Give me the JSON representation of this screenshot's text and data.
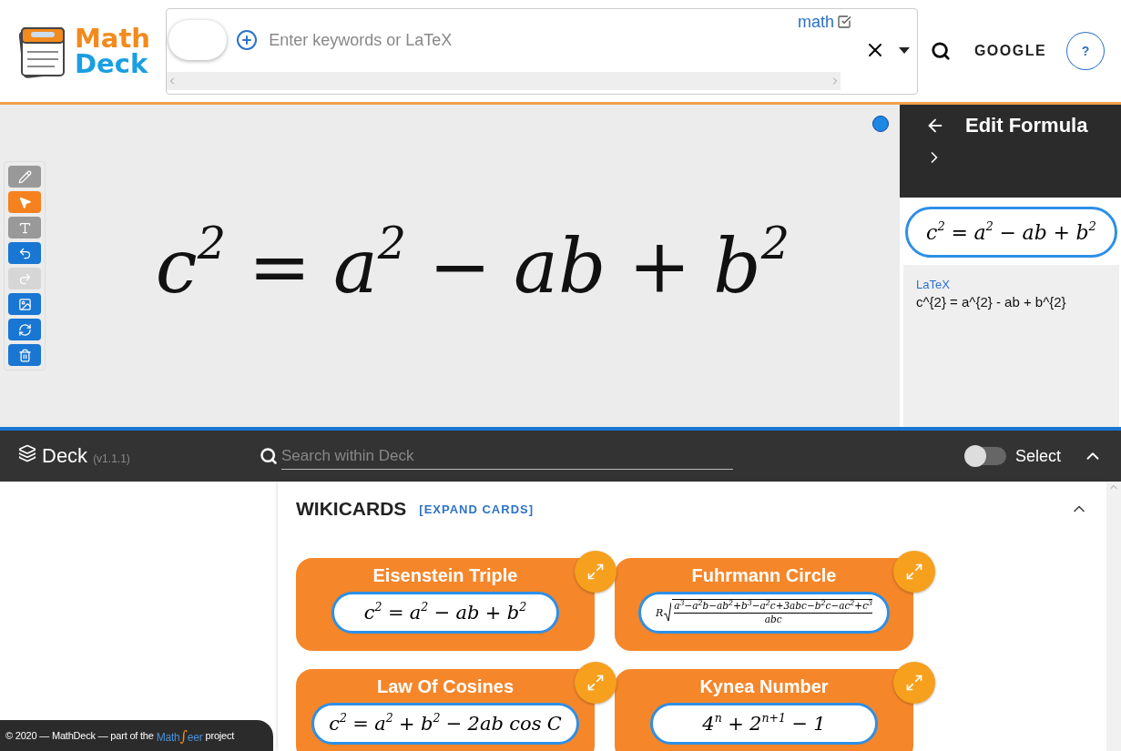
{
  "logo": {
    "line1": "Math",
    "line2": "Deck"
  },
  "search": {
    "placeholder": "Enter keywords or LaTeX",
    "filter_label": "math",
    "filter_checked": true,
    "engine_button": "GOOGLE",
    "help_button": "?"
  },
  "canvas": {
    "formula": [
      "c$^{2}$",
      "=",
      "a$^{2}$",
      "−",
      "ab",
      "+",
      "b$^{2}$"
    ]
  },
  "tools": [
    {
      "kind": "pencil",
      "selected": false,
      "disabled": false
    },
    {
      "kind": "pointer",
      "selected": true,
      "disabled": false
    },
    {
      "kind": "text",
      "selected": false,
      "disabled": false
    },
    {
      "kind": "undo",
      "selected": false,
      "disabled": false
    },
    {
      "kind": "redo",
      "selected": false,
      "disabled": true
    },
    {
      "kind": "image",
      "selected": false,
      "disabled": false
    },
    {
      "kind": "refresh",
      "selected": false,
      "disabled": false
    },
    {
      "kind": "trash",
      "selected": false,
      "disabled": false
    }
  ],
  "editor": {
    "title": "Edit Formula",
    "preview": [
      "c$^{2}$",
      "=",
      "a$^{2}$",
      "−",
      "ab",
      "+",
      "b$^{2}$"
    ],
    "latex_label": "LaTeX",
    "latex_value": "c^{2} = a^{2} - ab + b^{2}"
  },
  "deck": {
    "title": "Deck",
    "version": "(v1.1.1)",
    "search_placeholder": "Search within Deck",
    "select_label": "Select",
    "select_on": false
  },
  "wikicards": {
    "title": "WIKICARDS",
    "expand_link": "[EXPAND CARDS]",
    "cards": [
      {
        "title": "Eisenstein Triple",
        "kind": "inline",
        "formula": [
          "c$^{2}$",
          "=",
          "a$^{2}$",
          "−",
          "ab",
          "+",
          "b$^{2}$"
        ]
      },
      {
        "title": "Fuhrmann Circle",
        "kind": "radical",
        "prefix": "R",
        "numerator": "a$^{3}$−a$^{2}$b−ab$^{2}$+b$^{3}$−a$^{2}$c+3abc−b$^{2}$c−ac$^{2}$+c$^{3}$",
        "denominator": "abc"
      },
      {
        "title": "Law Of Cosines",
        "kind": "inline",
        "formula": [
          "c$^{2}$",
          "=",
          "a$^{2}$",
          "+",
          "b$^{2}$",
          "−",
          "2ab",
          "cos",
          "C"
        ]
      },
      {
        "title": "Kynea Number",
        "kind": "inline",
        "formula": [
          "4$^{n}$",
          "+",
          "2$^{n+1}$",
          "−",
          "1"
        ]
      }
    ]
  },
  "footer": {
    "text": "© 2020 — MathDeck — part of the",
    "brand_left": "Math",
    "brand_mark": "∫",
    "brand_right": "eer",
    "suffix": "project"
  }
}
